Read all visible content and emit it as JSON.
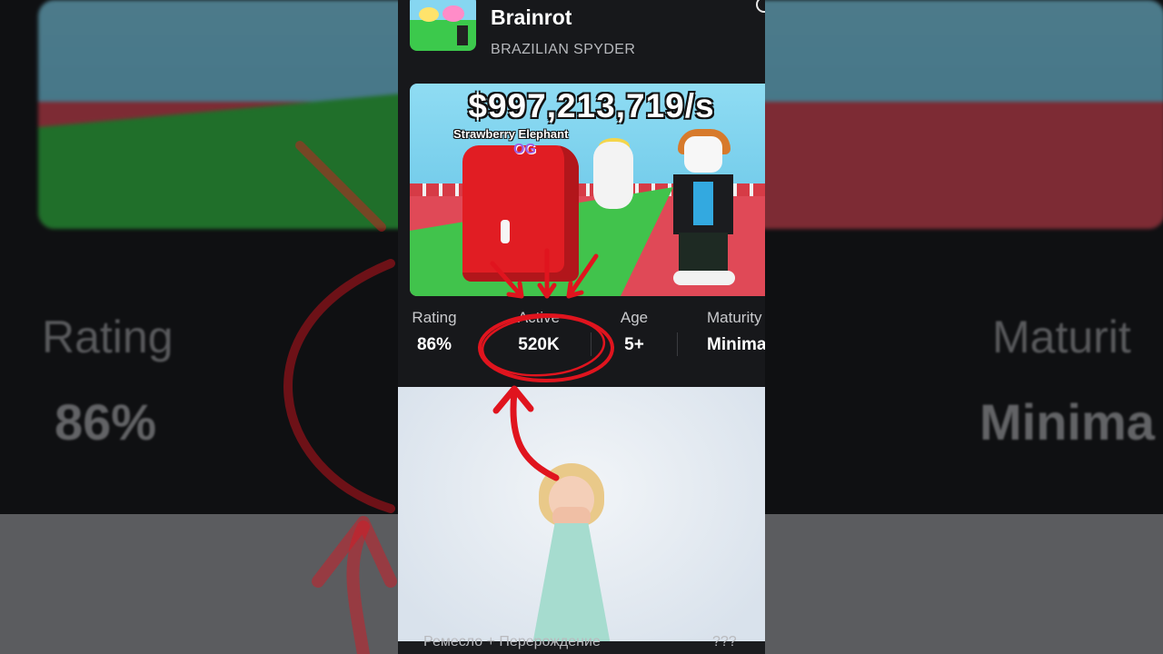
{
  "game": {
    "title": "Brainrot",
    "creator": "BRAZILIAN SPYDER"
  },
  "banner": {
    "earnings": "$997,213,719/s",
    "pet_name": "Strawberry Elephant",
    "pet_badge": "OG"
  },
  "stats": [
    {
      "label": "Rating",
      "value": "86%"
    },
    {
      "label": "Active",
      "value": "520K"
    },
    {
      "label": "Age",
      "value": "5+"
    },
    {
      "label": "Maturity",
      "value": "Minimal"
    }
  ],
  "bottom": {
    "left_text": "Ремесло + Перерождение",
    "right_text": "???"
  },
  "background": {
    "rating_label": "Rating",
    "rating_value": "86%",
    "maturity_label": "Maturit",
    "maturity_value": "Minima"
  },
  "colors": {
    "panel_bg": "#17181b",
    "annotation_red": "#e0141e",
    "text_primary": "#ffffff",
    "text_secondary": "#b7b9bd"
  },
  "icons": {
    "profile": "person-icon"
  }
}
